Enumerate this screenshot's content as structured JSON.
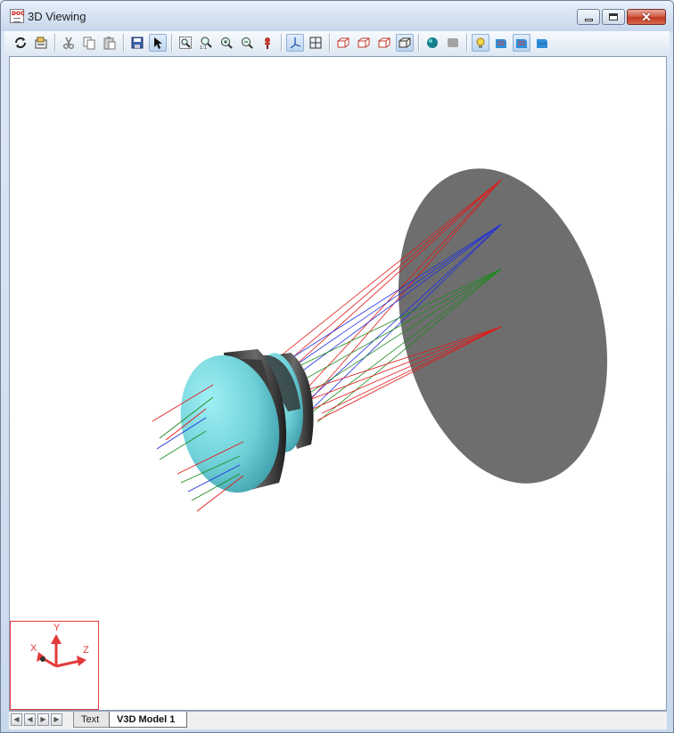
{
  "window": {
    "title": "3D Viewing",
    "app_icon_text": "DOC"
  },
  "title_controls": [
    {
      "name": "minimize-button"
    },
    {
      "name": "maximize-button"
    },
    {
      "name": "close-button",
      "glyph": "✕"
    }
  ],
  "toolbar": {
    "buttons": [
      {
        "name": "refresh-button",
        "icon": "refresh-icon"
      },
      {
        "name": "settings-button",
        "icon": "settings-icon"
      },
      {
        "name": "cut-button",
        "icon": "cut-icon"
      },
      {
        "name": "copy-button",
        "icon": "copy-icon"
      },
      {
        "name": "paste-button",
        "icon": "paste-icon"
      },
      {
        "name": "save-button",
        "icon": "save-icon"
      },
      {
        "name": "select-button",
        "icon": "arrow-pointer-icon",
        "active": true
      },
      {
        "name": "zoom-window-button",
        "icon": "zoom-window-icon"
      },
      {
        "name": "zoom-fit-button",
        "icon": "zoom-fit-icon"
      },
      {
        "name": "zoom-in-button",
        "icon": "zoom-in-icon"
      },
      {
        "name": "zoom-out-button",
        "icon": "zoom-out-icon"
      },
      {
        "name": "pan-button",
        "icon": "pin-icon"
      },
      {
        "name": "axes-view-button",
        "icon": "axes-icon",
        "active": true
      },
      {
        "name": "grid-view-button",
        "icon": "grid-icon"
      },
      {
        "name": "view-x-button",
        "icon": "box-view-icon"
      },
      {
        "name": "view-y-button",
        "icon": "box-view-icon"
      },
      {
        "name": "view-z-button",
        "icon": "box-view-icon"
      },
      {
        "name": "view-iso-button",
        "icon": "box-view-icon",
        "active": true
      },
      {
        "name": "shaded-button",
        "icon": "sphere-icon"
      },
      {
        "name": "flat-button",
        "icon": "cube-icon"
      },
      {
        "name": "lighting-button",
        "icon": "light-bulb-icon",
        "active": true
      },
      {
        "name": "layer-1-button",
        "icon": "layer-icon"
      },
      {
        "name": "layer-2-button",
        "icon": "layer-icon",
        "active": true
      },
      {
        "name": "layer-3-button",
        "icon": "layer-icon"
      }
    ]
  },
  "axis_triad": {
    "x": "X",
    "y": "Y",
    "z": "Z"
  },
  "nav_buttons": [
    "first-page-button",
    "prev-page-button",
    "next-page-button",
    "last-page-button"
  ],
  "tabs": [
    {
      "label": "Text",
      "active": false
    },
    {
      "label": "V3D Model 1",
      "active": true
    }
  ],
  "colors": {
    "lens_fill": "#6fd0d8",
    "lens_edge": "#3a3a3a",
    "image_plane": "#6e6e6e",
    "ray_red": "#e21a1a",
    "ray_green": "#1c8a1c",
    "ray_blue": "#1f2fe0"
  }
}
